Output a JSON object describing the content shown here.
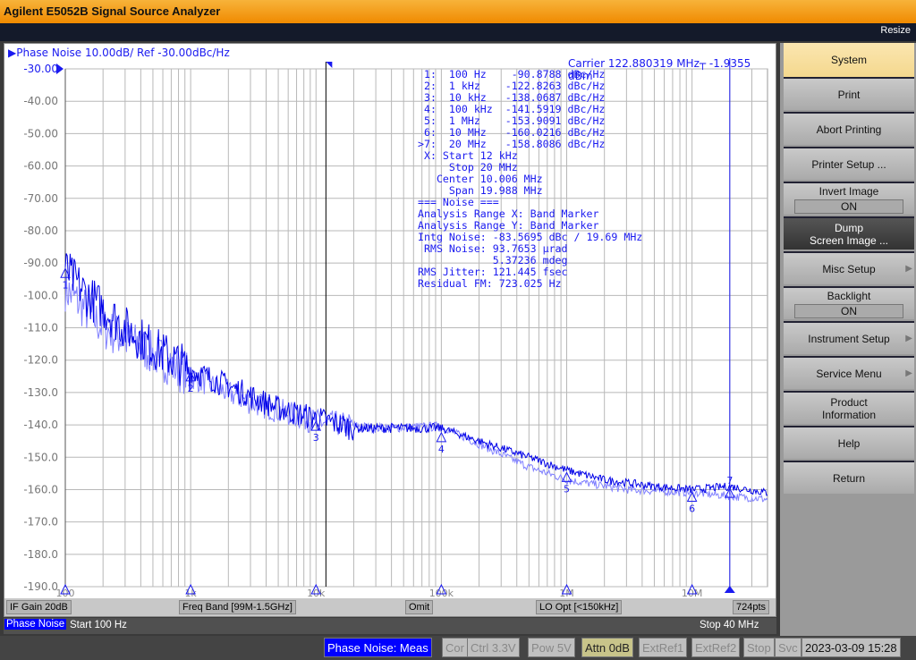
{
  "app": {
    "title": "Agilent E5052B Signal Source Analyzer",
    "resize_label": "Resize"
  },
  "trace": {
    "title": "Phase Noise 10.00dB/ Ref -30.00dBc/Hz",
    "carrier": "Carrier 122.880319 MHz┬ -1.9355 dBm"
  },
  "readout": [
    " 1:  100 Hz    -90.8788 dBc/Hz",
    " 2:  1 kHz    -122.8263 dBc/Hz",
    " 3:  10 kHz   -138.0687 dBc/Hz",
    " 4:  100 kHz  -141.5919 dBc/Hz",
    " 5:  1 MHz    -153.9091 dBc/Hz",
    " 6:  10 MHz   -160.0216 dBc/Hz",
    ">7:  20 MHz   -158.8086 dBc/Hz",
    " X: Start 12 kHz",
    "     Stop 20 MHz",
    "   Center 10.006 MHz",
    "     Span 19.988 MHz",
    "=== Noise ===",
    "Analysis Range X: Band Marker",
    "Analysis Range Y: Band Marker",
    "Intg Noise: -83.5695 dBc / 19.69 MHz",
    " RMS Noise: 93.7653 µrad",
    "            5.37236 mdeg",
    "RMS Jitter: 121.445 fsec",
    "Residual FM: 723.025 Hz"
  ],
  "chart_data": {
    "type": "line",
    "xscale": "log",
    "xlim": [
      100,
      40000000
    ],
    "ylim": [
      -190,
      -30
    ],
    "grid": true,
    "yticks": [
      -30,
      -40,
      -50,
      -60,
      -70,
      -80,
      -90,
      -100,
      -110,
      -120,
      -130,
      -140,
      -150,
      -160,
      -170,
      -180,
      -190
    ],
    "ytick_labels": [
      "-30.00",
      "-40.00",
      "-50.00",
      "-60.00",
      "-70.00",
      "-80.00",
      "-90.00",
      "-100.0",
      "-110.0",
      "-120.0",
      "-130.0",
      "-140.0",
      "-150.0",
      "-160.0",
      "-170.0",
      "-180.0",
      "-190.0"
    ],
    "xticks": [
      100,
      1000,
      10000,
      100000,
      1000000,
      10000000
    ],
    "xtick_labels": [
      "100",
      "1k",
      "10k",
      "100k",
      "1M",
      "10M"
    ],
    "series": [
      {
        "color": "#0000e8",
        "x": [
          100,
          150,
          200,
          300,
          500,
          1000,
          2000,
          3000,
          5000,
          10000,
          20000,
          50000,
          100000,
          200000,
          500000,
          1000000,
          2000000,
          5000000,
          10000000,
          20000000,
          40000000
        ],
        "y": [
          -92,
          -100,
          -104,
          -110,
          -116,
          -123,
          -128,
          -131,
          -135,
          -138,
          -141,
          -141,
          -141,
          -145,
          -150,
          -154,
          -157,
          -159,
          -160,
          -159,
          -161
        ]
      },
      {
        "color": "#8080ff",
        "x": [
          100,
          200,
          500,
          1000,
          3000,
          10000,
          30000,
          100000,
          200000,
          500000,
          1000000,
          3000000,
          10000000,
          40000000
        ],
        "y": [
          -98,
          -110,
          -118,
          -125,
          -133,
          -139,
          -141,
          -140.5,
          -146,
          -153,
          -157,
          -160,
          -161,
          -163
        ]
      }
    ],
    "markers": [
      {
        "id": "1",
        "x": 100,
        "y": -90.8788
      },
      {
        "id": "2",
        "x": 1000,
        "y": -122.8263
      },
      {
        "id": "3",
        "x": 10000,
        "y": -138.0687
      },
      {
        "id": "4",
        "x": 100000,
        "y": -141.5919
      },
      {
        "id": "5",
        "x": 1000000,
        "y": -153.9091
      },
      {
        "id": "6",
        "x": 10000000,
        "y": -160.0216
      },
      {
        "id": "7",
        "x": 20000000,
        "y": -158.8086
      }
    ],
    "band_start": 12000,
    "band_stop": 20000000,
    "colors": {
      "trace": "#0000e8",
      "memory": "#8080ff",
      "grid": "#b8b8b8",
      "text": "#1a1af0"
    }
  },
  "channel_bar": {
    "if_gain": "IF Gain 20dB",
    "freq_band": "Freq Band [99M-1.5GHz]",
    "omit": "Omit",
    "lo_opt": "LO Opt [<150kHz]",
    "points": "724pts"
  },
  "status": {
    "meas": "Phase Noise",
    "start": "Start 100 Hz",
    "stop": "Stop 40 MHz"
  },
  "bottom": {
    "meas": "Phase Noise: Meas",
    "cor": "Cor",
    "ctrl": "Ctrl  3.3V",
    "pow": "Pow  5V",
    "attn": "Attn 0dB",
    "extref1": "ExtRef1",
    "extref2": "ExtRef2",
    "stop": "Stop",
    "svc": "Svc",
    "datetime": "2023-03-09 15:28"
  },
  "softkeys": {
    "system": "System",
    "print": "Print",
    "abort": "Abort Printing",
    "printer_setup": "Printer Setup ...",
    "invert": "Invert Image",
    "invert_val": "ON",
    "dump1": "Dump",
    "dump2": "Screen Image ...",
    "misc": "Misc Setup",
    "backlight": "Backlight",
    "backlight_val": "ON",
    "instrument": "Instrument Setup",
    "service": "Service Menu",
    "product1": "Product",
    "product2": "Information",
    "help": "Help",
    "return": "Return"
  }
}
